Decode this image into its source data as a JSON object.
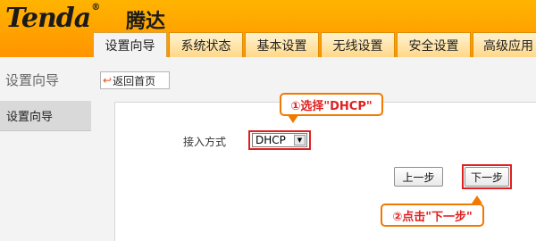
{
  "brand": {
    "logo": "Tenda",
    "reg_mark": "®",
    "logo_cn": "腾达"
  },
  "tabs": [
    {
      "label": "设置向导",
      "active": true
    },
    {
      "label": "系统状态",
      "active": false
    },
    {
      "label": "基本设置",
      "active": false
    },
    {
      "label": "无线设置",
      "active": false
    },
    {
      "label": "安全设置",
      "active": false
    },
    {
      "label": "高级应用",
      "active": false
    }
  ],
  "section_title": "设置向导",
  "back_home_label": "返回首页",
  "sidebar": {
    "items": [
      {
        "label": "设置向导",
        "selected": true
      }
    ]
  },
  "form": {
    "access_label": "接入方式",
    "access_value": "DHCP",
    "prev_label": "上一步",
    "next_label": "下一步"
  },
  "annotations": {
    "step1": "①选择\"DHCP\"",
    "step2": "②点击\"下一步\""
  },
  "colors": {
    "header": "#ff9f00",
    "highlight": "#e02020",
    "callout_border": "#f07a00"
  }
}
